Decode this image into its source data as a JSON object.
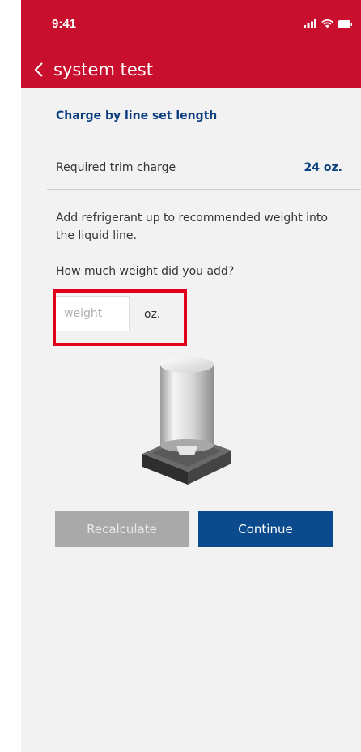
{
  "status_bar": {
    "time": "9:41"
  },
  "nav": {
    "title": "system test"
  },
  "section": {
    "title": "Charge by line set length"
  },
  "trim": {
    "label": "Required trim charge",
    "value": "24 oz."
  },
  "instruction": "Add refrigerant up to recommended weight into the liquid line.",
  "question": "How much weight did you add?",
  "weight_input": {
    "placeholder": "weight",
    "value": "",
    "unit": "oz."
  },
  "buttons": {
    "recalculate": "Recalculate",
    "continue": "Continue"
  },
  "colors": {
    "header": "#c8102e",
    "accent": "#0b4a8c",
    "disabled": "#a9a9a9",
    "highlight": "#e0001a"
  },
  "icons": [
    "signal-icon",
    "wifi-icon",
    "battery-icon",
    "back-chevron-icon",
    "refrigerant-scale-illustration"
  ]
}
